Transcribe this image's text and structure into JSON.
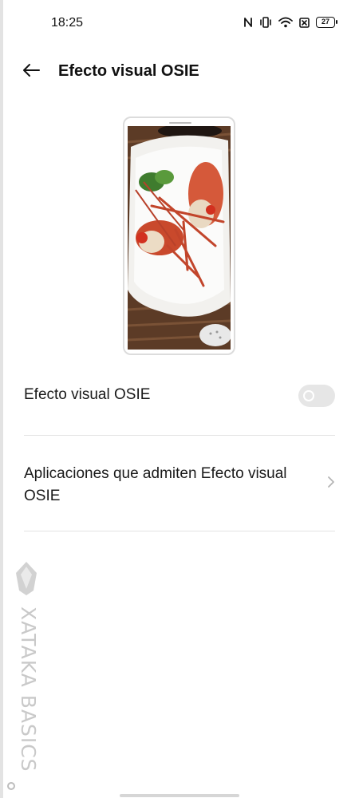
{
  "status_bar": {
    "time": "18:25",
    "icons": [
      "nfc-icon",
      "vibrate-icon",
      "wifi-icon",
      "sim-off-icon",
      "battery-icon"
    ],
    "battery_level": "27"
  },
  "header": {
    "back_icon": "arrow-left-icon",
    "title": "Efecto visual OSIE"
  },
  "preview": {
    "image": "lobster-plate-photo"
  },
  "settings": {
    "toggle_label": "Efecto visual OSIE",
    "toggle_on": false,
    "apps_label": "Aplicaciones que admiten Efecto visual OSIE",
    "apps_icon": "chevron-right-icon"
  },
  "watermark": {
    "text": "XATAKA BASICS"
  },
  "colors": {
    "background": "#ffffff",
    "text": "#1a1a1a",
    "divider": "#e2e2e2",
    "toggle_off": "#e6e6e6",
    "watermark": "#c9c9c9"
  }
}
